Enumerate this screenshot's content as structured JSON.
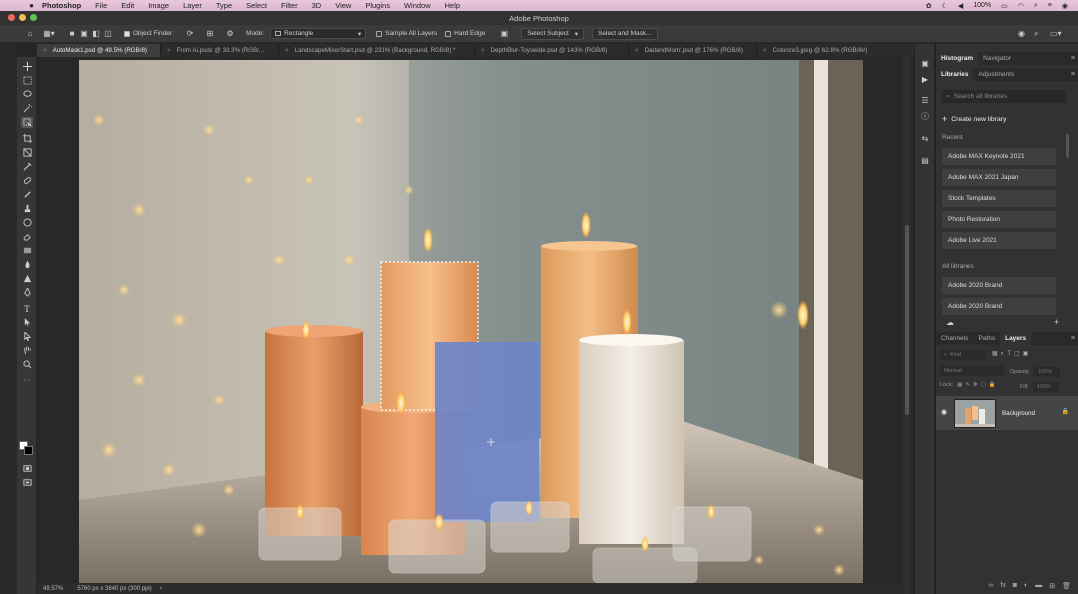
{
  "menubar": {
    "app_name": "Photoshop",
    "items": [
      "File",
      "Edit",
      "Image",
      "Layer",
      "Type",
      "Select",
      "Filter",
      "3D",
      "View",
      "Plugins",
      "Window",
      "Help"
    ],
    "battery": "100%"
  },
  "titlebar": {
    "title": "Adobe Photoshop"
  },
  "options_bar": {
    "object_finder_label": "Object Finder",
    "mode_label": "Mode:",
    "mode_value": "Rectangle",
    "sample_all_layers_label": "Sample All Layers",
    "hard_edge_label": "Hard Edge",
    "select_subject_label": "Select Subject",
    "select_and_mask_label": "Select and Mask..."
  },
  "tabs": [
    {
      "label": "AutoMask1.psd @ 49.5% (RGB/8)",
      "active": true
    },
    {
      "label": "From Ai.psdc @ 33.3% (RGB/...",
      "active": false
    },
    {
      "label": "LandscapeMixerStart.psd @ 231% (Background, RGB/8) *",
      "active": false
    },
    {
      "label": "DepthBlur-Toyswide.psd @ 143% (RGB/8)",
      "active": false
    },
    {
      "label": "DadandMom'.psd @ 176% (RGB/8)",
      "active": false
    },
    {
      "label": "Colorize3.jpeg @ 62.8% (RGB/8#)",
      "active": false
    }
  ],
  "statusbar": {
    "zoom": "49.57%",
    "doc_info": "5760 px x 3840 px (300 ppi)"
  },
  "panels": {
    "top_tabs": [
      "Histogram",
      "Navigator"
    ],
    "lib_tabs": [
      "Libraries",
      "Adjustments"
    ],
    "search_placeholder": "Search all libraries",
    "create_new_library": "Create new library",
    "recent_label": "Recent",
    "recent_items": [
      "Adobe MAX Keynote 2021",
      "Adobe MAX 2021 Japan",
      "Stock Templates",
      "Photo Restoration",
      "Adobe Live 2021"
    ],
    "all_libraries_label": "All libraries",
    "all_items": [
      "Adobe 2020 Brand",
      "Adobe 2020 Brand"
    ],
    "layer_tabs": [
      "Channels",
      "Paths",
      "Layers"
    ],
    "layer_kind_placeholder": "Kind",
    "blend_mode": "Normal",
    "opacity_label": "Opacity:",
    "opacity_value": "100%",
    "lock_label": "Lock:",
    "fill_label": "Fill:",
    "fill_value": "100%",
    "layer_name": "Background"
  },
  "colors": {
    "accent": "#3d3d3d",
    "menubar": "#e3c0d6"
  }
}
